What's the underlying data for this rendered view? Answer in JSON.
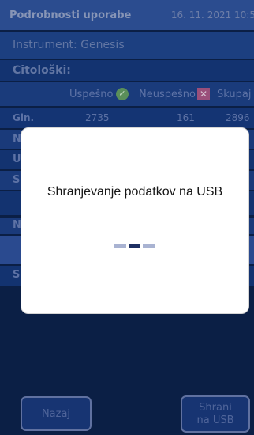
{
  "header": {
    "title": "Podrobnosti uporabe",
    "date": "16. 11. 2021 10:5"
  },
  "instrument": {
    "text": "Instrument: Genesis"
  },
  "section": {
    "cytology": "Citološki:"
  },
  "columns": {
    "success": "Uspešno",
    "failed": "Neuspešno",
    "total": "Skupaj"
  },
  "gin_row": {
    "label": "Gin.",
    "success": "2735",
    "failed": "161",
    "total": "2896"
  },
  "fragments": {
    "n1": "N",
    "u": "U",
    "s1": "S",
    "n3": "N",
    "s2": "S"
  },
  "buttons": {
    "back": "Nazaj",
    "save_usb": "Shrani na USB"
  },
  "modal": {
    "message": "Shranjevanje podatkov na USB"
  }
}
